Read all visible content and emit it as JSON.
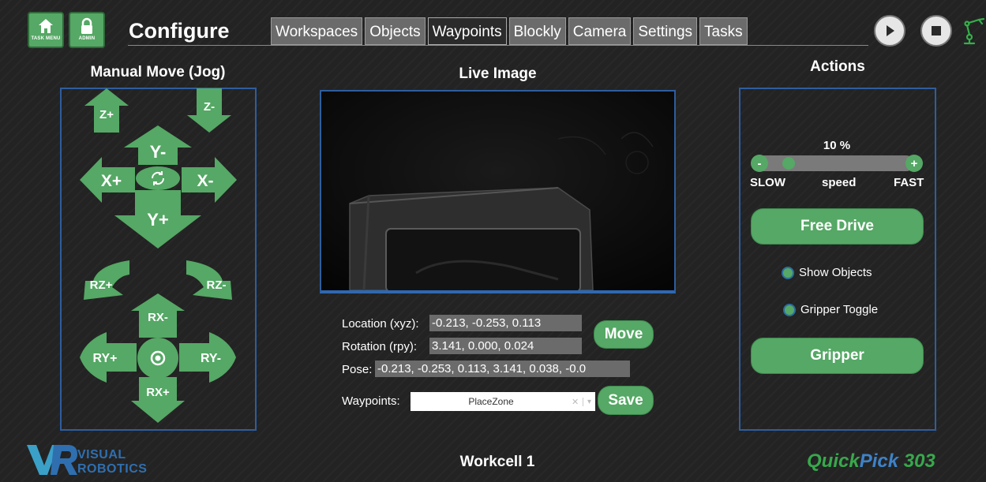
{
  "header": {
    "task_menu_label": "TASK MENU",
    "admin_label": "ADMIN",
    "title": "Configure",
    "tabs": [
      {
        "label": "Workspaces",
        "active": false
      },
      {
        "label": "Objects",
        "active": false
      },
      {
        "label": "Waypoints",
        "active": true
      },
      {
        "label": "Blockly",
        "active": false
      },
      {
        "label": "Camera",
        "active": false
      },
      {
        "label": "Settings",
        "active": false
      },
      {
        "label": "Tasks",
        "active": false
      }
    ]
  },
  "jog": {
    "heading": "Manual Move (Jog)",
    "z_plus": "Z+",
    "z_minus": "Z-",
    "y_minus": "Y-",
    "y_plus": "Y+",
    "x_plus": "X+",
    "x_minus": "X-",
    "rz_plus": "RZ+",
    "rz_minus": "RZ-",
    "rx_minus": "RX-",
    "rx_plus": "RX+",
    "ry_plus": "RY+",
    "ry_minus": "RY-"
  },
  "live": {
    "heading": "Live Image"
  },
  "pose": {
    "location_label": "Location (xyz):",
    "location_value": "-0.213, -0.253, 0.113",
    "rotation_label": "Rotation (rpy):",
    "rotation_value": "3.141, 0.000, 0.024",
    "pose_label": "Pose:",
    "pose_value": "-0.213, -0.253, 0.113, 3.141, 0.038, -0.0",
    "move_label": "Move",
    "waypoints_label": "Waypoints:",
    "waypoints_selected": "PlaceZone",
    "save_label": "Save"
  },
  "actions": {
    "heading": "Actions",
    "speed_value_text": "10 %",
    "speed_fraction": 0.1,
    "minus_label": "-",
    "plus_label": "+",
    "slow_label": "SLOW",
    "speed_label": "speed",
    "fast_label": "FAST",
    "free_drive_label": "Free Drive",
    "show_objects_label": "Show Objects",
    "gripper_toggle_label": "Gripper Toggle",
    "gripper_label": "Gripper"
  },
  "footer": {
    "logo_visual": "VISUAL",
    "logo_robotics": "ROBOTICS",
    "workcell": "Workcell 1",
    "product_quick": "Quick",
    "product_pick": "Pick",
    "product_num": " 303"
  },
  "colors": {
    "background": "#232323",
    "accent_green": "#55a865",
    "panel_border": "#2e5d9e",
    "product_green": "#38a84c",
    "product_blue": "#3e82c8"
  }
}
